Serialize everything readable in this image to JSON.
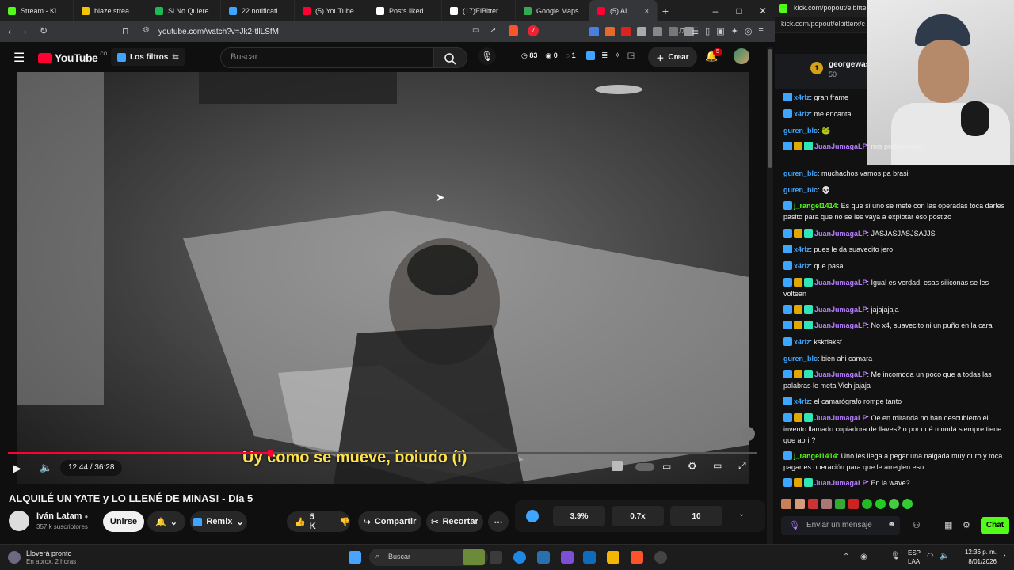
{
  "browser": {
    "tabs": [
      {
        "label": "Stream - Kick Da",
        "color": "#53fc18"
      },
      {
        "label": "blaze.stream/elb",
        "color": "#f5c400"
      },
      {
        "label": "Si No Quiere",
        "color": "#1db954"
      },
      {
        "label": "22 notifications",
        "color": "#3ea6ff"
      },
      {
        "label": "(5) YouTube",
        "color": "#ff0033"
      },
      {
        "label": "Posts liked by El",
        "color": "#ffffff"
      },
      {
        "label": "(17)ElBitterX (@e",
        "color": "#ffffff"
      },
      {
        "label": "Google Maps",
        "color": "#34a853"
      },
      {
        "label": "(5) ALQUILÉ",
        "color": "#ff0033"
      }
    ],
    "url": "youtube.com/watch?v=Jk2-tllLSfM",
    "extension_badge": "7"
  },
  "youtube": {
    "logo_text": "YouTube",
    "country": "CO",
    "filters_label": "Los filtros",
    "search_placeholder": "Buscar",
    "stats": [
      "83",
      "0",
      "1"
    ],
    "create_label": "Crear",
    "notifications_count": "5"
  },
  "video": {
    "subtitle": "Uy como se mueve, boludo (ī)",
    "time": "12:44 / 36:28",
    "progress": 0.35
  },
  "meta": {
    "title": "ALQUILÉ UN YATE y LO LLENÉ DE MINAS! - Día 5",
    "channel": "Iván Latam",
    "subscribers": "357 k suscriptores",
    "join_label": "Unirse",
    "remix_label": "Remix",
    "likes": "5 K",
    "share_label": "Compartir",
    "clip_label": "Recortar",
    "ext_stats": [
      "3.9%",
      "0.7x",
      "10"
    ]
  },
  "chat": {
    "url": "kick.com/popout/elbitterx/c",
    "top_user": "georgewas",
    "top_amount": "50",
    "top_rank": "1",
    "messages": [
      {
        "user": "x4rlz",
        "color": "#3ea6ff",
        "text": "gran frame",
        "badges": 1
      },
      {
        "user": "x4rlz",
        "color": "#3ea6ff",
        "text": "me encanta",
        "badges": 1
      },
      {
        "user": "guren_blc",
        "color": "#3ea6ff",
        "text": "🐸",
        "badges": 0
      },
      {
        "user": "JuanJumagaLP",
        "color": "#b57cff",
        "text": "mis preferencias",
        "badges": 3
      },
      {
        "user": "guren_blc",
        "color": "#3ea6ff",
        "text": "muchachos vamos pa brasil",
        "badges": 0
      },
      {
        "user": "guren_blc",
        "color": "#3ea6ff",
        "text": "💀",
        "badges": 0
      },
      {
        "user": "j_rangel1414",
        "color": "#53fc18",
        "text": "Es que si uno se mete con las operadas toca darles pasito para que no se les vaya a explotar eso postizo",
        "badges": 1
      },
      {
        "user": "JuanJumagaLP",
        "color": "#b57cff",
        "text": "JASJASJASJSAJJS",
        "badges": 3
      },
      {
        "user": "x4rlz",
        "color": "#3ea6ff",
        "text": "pues le da suavecito jero",
        "badges": 1
      },
      {
        "user": "x4rlz",
        "color": "#3ea6ff",
        "text": "que pasa",
        "badges": 1
      },
      {
        "user": "JuanJumagaLP",
        "color": "#b57cff",
        "text": "Igual es verdad, esas siliconas se les voltean",
        "badges": 3
      },
      {
        "user": "JuanJumagaLP",
        "color": "#b57cff",
        "text": "jajajajaja",
        "badges": 3
      },
      {
        "user": "JuanJumagaLP",
        "color": "#b57cff",
        "text": "No x4, suavecito ni un puño en la cara",
        "badges": 3
      },
      {
        "user": "x4rlz",
        "color": "#3ea6ff",
        "text": "kskdaksf",
        "badges": 1
      },
      {
        "user": "guren_blc",
        "color": "#3ea6ff",
        "text": "bien ahi camara",
        "badges": 0
      },
      {
        "user": "JuanJumagaLP",
        "color": "#b57cff",
        "text": "Me incomoda un poco que a todas las palabras le meta Vich jajaja",
        "badges": 3
      },
      {
        "user": "x4rlz",
        "color": "#3ea6ff",
        "text": "el camarógrafo rompe tanto",
        "badges": 1
      },
      {
        "user": "JuanJumagaLP",
        "color": "#b57cff",
        "text": "Oe en miranda no han descubierto el invento llamado copiadora de llaves? o por qué mondá siempre tiene que abrir?",
        "badges": 3
      },
      {
        "user": "j_rangel1414",
        "color": "#53fc18",
        "text": "Uno les llega a pegar una nalgada muy duro y toca pagar es operación para que le arreglen eso",
        "badges": 1
      },
      {
        "user": "JuanJumagaLP",
        "color": "#b57cff",
        "text": "En la wave?",
        "badges": 3
      }
    ],
    "input_placeholder": "Enviar un mensaje",
    "send_label": "Chat"
  },
  "taskbar": {
    "weather_title": "Lloverá pronto",
    "weather_sub": "En aprox. 2 horas",
    "search_label": "Buscar",
    "lang": "ESP",
    "lang2": "LAA",
    "time": "12:36 p. m.",
    "date": "8/01/2026"
  }
}
